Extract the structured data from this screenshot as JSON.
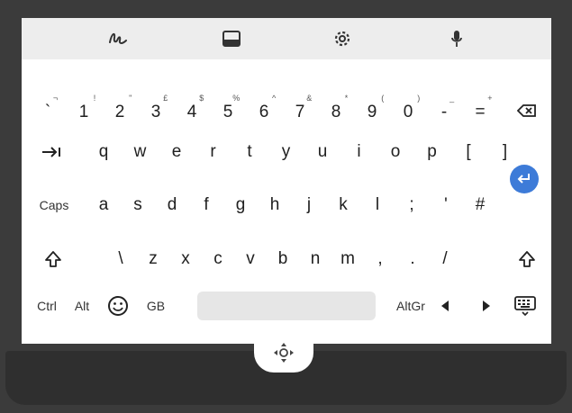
{
  "toolbar": {
    "icons": [
      "handwriting-icon",
      "keyboard-layout-icon",
      "gear-icon",
      "microphone-icon"
    ]
  },
  "rows": {
    "number": [
      {
        "main": "`",
        "shift": "¬"
      },
      {
        "main": "1",
        "shift": "!"
      },
      {
        "main": "2",
        "shift": "\""
      },
      {
        "main": "3",
        "shift": "£"
      },
      {
        "main": "4",
        "shift": "$"
      },
      {
        "main": "5",
        "shift": "%"
      },
      {
        "main": "6",
        "shift": "^"
      },
      {
        "main": "7",
        "shift": "&"
      },
      {
        "main": "8",
        "shift": "*"
      },
      {
        "main": "9",
        "shift": "("
      },
      {
        "main": "0",
        "shift": ")"
      },
      {
        "main": "-",
        "shift": "_"
      },
      {
        "main": "=",
        "shift": "+"
      }
    ],
    "qwerty": [
      "q",
      "w",
      "e",
      "r",
      "t",
      "y",
      "u",
      "i",
      "o",
      "p",
      "[",
      "]"
    ],
    "home_label": "Caps",
    "home": [
      "a",
      "s",
      "d",
      "f",
      "g",
      "h",
      "j",
      "k",
      "l",
      ";",
      "'",
      "#"
    ],
    "bottom": [
      "\\",
      "z",
      "x",
      "c",
      "v",
      "b",
      "n",
      "m",
      ",",
      ".",
      "/"
    ]
  },
  "controls": {
    "ctrl": "Ctrl",
    "alt": "Alt",
    "lang": "GB",
    "altgr": "AltGr"
  },
  "colors": {
    "accent": "#3d7bd8",
    "toolbar_bg": "#ededed",
    "key_text": "#202020"
  }
}
